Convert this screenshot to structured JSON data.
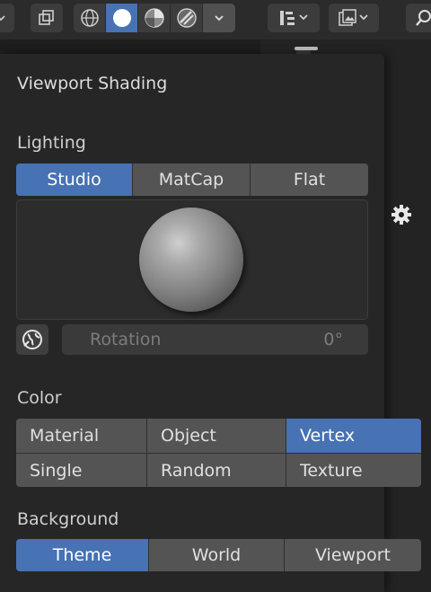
{
  "panel": {
    "title": "Viewport Shading",
    "lighting": {
      "label": "Lighting",
      "options": [
        "Studio",
        "MatCap",
        "Flat"
      ],
      "selected": "Studio",
      "rotation_label": "Rotation",
      "rotation_value": "0°"
    },
    "color": {
      "label": "Color",
      "options": [
        "Material",
        "Object",
        "Vertex",
        "Single",
        "Random",
        "Texture"
      ],
      "selected": "Vertex"
    },
    "background": {
      "label": "Background",
      "options": [
        "Theme",
        "World",
        "Viewport"
      ],
      "selected": "Theme"
    }
  },
  "colors": {
    "accent": "#4772b3",
    "panel_bg": "#262626",
    "button_bg": "#545454"
  },
  "icons": {
    "toolbar": [
      "overlay-icon",
      "wireframe-shading-icon",
      "solid-shading-icon",
      "material-preview-icon",
      "rendered-shading-icon",
      "chevron-down-icon",
      "outliner-filter-icon",
      "display-mode-icon",
      "search-icon"
    ],
    "panel": [
      "settings-gear-icon",
      "world-lighting-icon"
    ]
  }
}
